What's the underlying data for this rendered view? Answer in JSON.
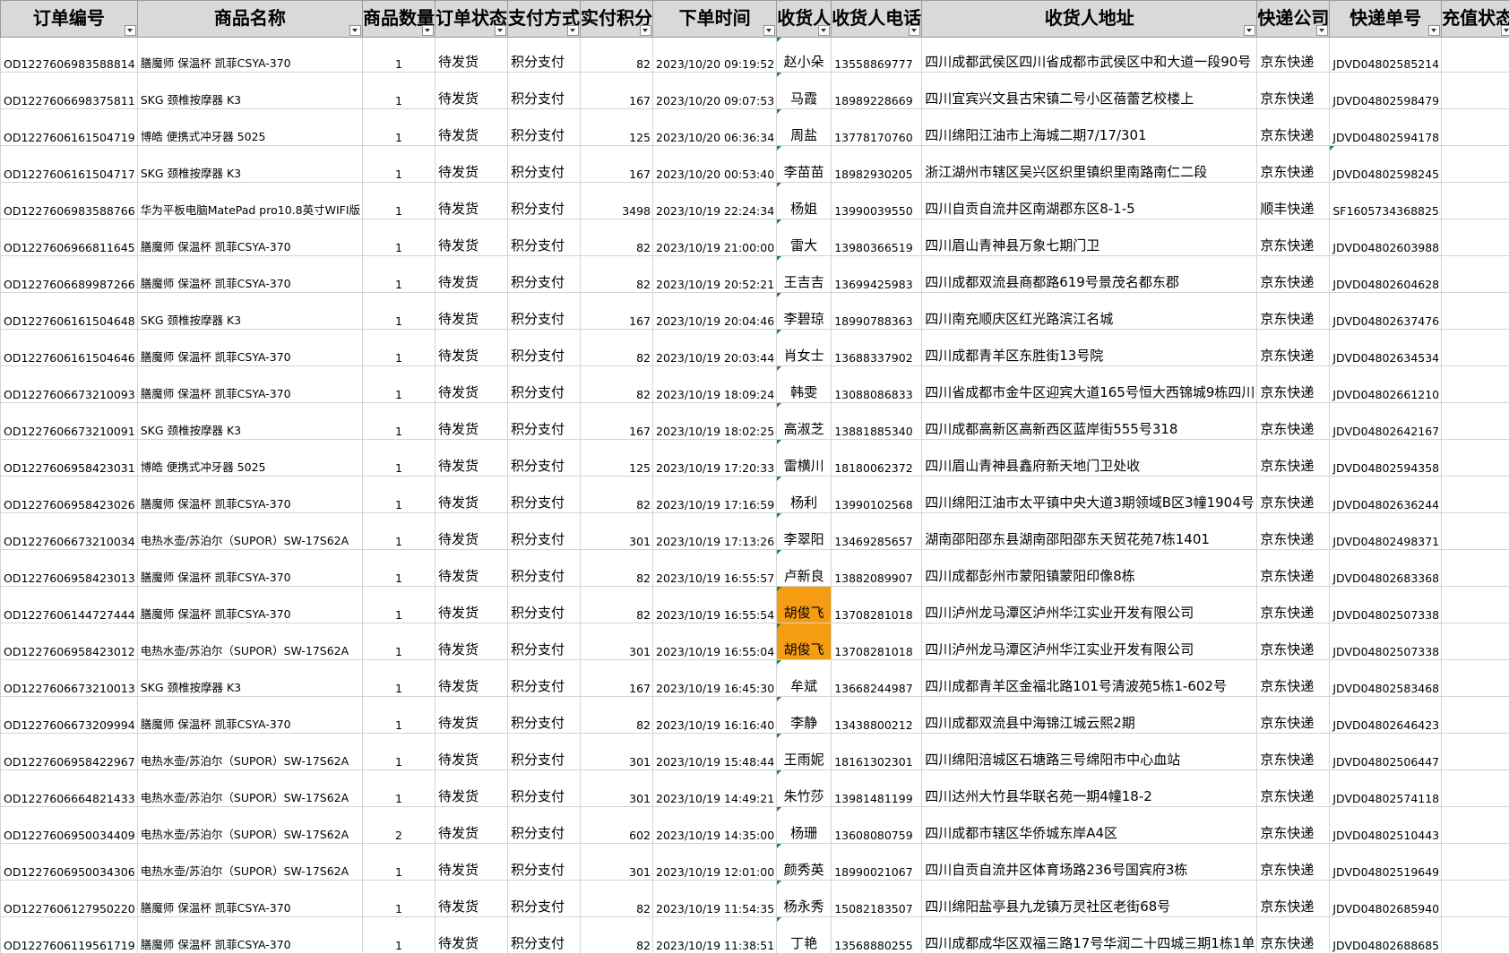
{
  "headers": [
    {
      "label": "订单编号"
    },
    {
      "label": "商品名称"
    },
    {
      "label": "商品数量"
    },
    {
      "label": "订单状态"
    },
    {
      "label": "支付方式"
    },
    {
      "label": "实付积分"
    },
    {
      "label": "下单时间"
    },
    {
      "label": "收货人"
    },
    {
      "label": "收货人电话"
    },
    {
      "label": "收货人地址"
    },
    {
      "label": "快递公司"
    },
    {
      "label": "快递单号"
    },
    {
      "label": "充值状态"
    }
  ],
  "highlight_color": "#f59c12",
  "rows": [
    {
      "order_id": "OD1227606983588814",
      "product": "膳魔师 保温杯 凯菲CSYA-370",
      "qty": "1",
      "status": "待发货",
      "pay": "积分支付",
      "points": "82",
      "time": "2023/10/20 09:19:52",
      "name": "赵小朵",
      "phone": "13558869777",
      "address": "四川成都武侯区四川省成都市武侯区中和大道一段90号",
      "courier": "京东快递",
      "tracking": "JDVD04802585214",
      "recharge": ""
    },
    {
      "order_id": "OD1227606698375811",
      "product": "SKG 颈椎按摩器 K3",
      "qty": "1",
      "status": "待发货",
      "pay": "积分支付",
      "points": "167",
      "time": "2023/10/20 09:07:53",
      "name": "马霞",
      "phone": "18989228669",
      "address": "四川宜宾兴文县古宋镇二号小区蓓蕾艺校楼上",
      "courier": "京东快递",
      "tracking": "JDVD04802598479",
      "recharge": ""
    },
    {
      "order_id": "OD1227606161504719",
      "product": "博皓 便携式冲牙器 5025",
      "qty": "1",
      "status": "待发货",
      "pay": "积分支付",
      "points": "125",
      "time": "2023/10/20 06:36:34",
      "name": "周盐",
      "phone": "13778170760",
      "address": "四川绵阳江油市上海城二期7/17/301",
      "courier": "京东快递",
      "tracking": "JDVD04802594178",
      "recharge": ""
    },
    {
      "order_id": "OD1227606161504717",
      "product": "SKG 颈椎按摩器 K3",
      "qty": "1",
      "status": "待发货",
      "pay": "积分支付",
      "points": "167",
      "time": "2023/10/20 00:53:40",
      "name": "李苗苗",
      "phone": "18982930205",
      "address": "浙江湖州市辖区吴兴区织里镇织里南路南仁二段",
      "courier": "京东快递",
      "tracking": "JDVD04802598245",
      "recharge": ""
    },
    {
      "order_id": "OD1227606983588766",
      "product": "华为平板电脑MatePad pro10.8英寸WIFI版",
      "qty": "1",
      "status": "待发货",
      "pay": "积分支付",
      "points": "3498",
      "time": "2023/10/19 22:24:34",
      "name": "杨姐",
      "phone": "13990039550",
      "address": "四川自贡自流井区南湖郡东区8-1-5",
      "courier": "顺丰快递",
      "tracking": "SF1605734368825",
      "recharge": ""
    },
    {
      "order_id": "OD1227606966811645",
      "product": "膳魔师 保温杯 凯菲CSYA-370",
      "qty": "1",
      "status": "待发货",
      "pay": "积分支付",
      "points": "82",
      "time": "2023/10/19 21:00:00",
      "name": "雷大",
      "phone": "13980366519",
      "address": "四川眉山青神县万象七期门卫",
      "courier": "京东快递",
      "tracking": "JDVD04802603988",
      "recharge": ""
    },
    {
      "order_id": "OD1227606689987266",
      "product": "膳魔师 保温杯 凯菲CSYA-370",
      "qty": "1",
      "status": "待发货",
      "pay": "积分支付",
      "points": "82",
      "time": "2023/10/19 20:52:21",
      "name": "王吉吉",
      "phone": "13699425983",
      "address": "四川成都双流县商都路619号景茂名都东郡",
      "courier": "京东快递",
      "tracking": "JDVD04802604628",
      "recharge": ""
    },
    {
      "order_id": "OD1227606161504648",
      "product": "SKG 颈椎按摩器 K3",
      "qty": "1",
      "status": "待发货",
      "pay": "积分支付",
      "points": "167",
      "time": "2023/10/19 20:04:46",
      "name": "李碧琼",
      "phone": "18990788363",
      "address": "四川南充顺庆区红光路滨江名城",
      "courier": "京东快递",
      "tracking": "JDVD04802637476",
      "recharge": ""
    },
    {
      "order_id": "OD1227606161504646",
      "product": "膳魔师 保温杯 凯菲CSYA-370",
      "qty": "1",
      "status": "待发货",
      "pay": "积分支付",
      "points": "82",
      "time": "2023/10/19 20:03:44",
      "name": "肖女士",
      "phone": "13688337902",
      "address": "四川成都青羊区东胜街13号院",
      "courier": "京东快递",
      "tracking": "JDVD04802634534",
      "recharge": ""
    },
    {
      "order_id": "OD1227606673210093",
      "product": "膳魔师 保温杯 凯菲CSYA-370",
      "qty": "1",
      "status": "待发货",
      "pay": "积分支付",
      "points": "82",
      "time": "2023/10/19 18:09:24",
      "name": "韩雯",
      "phone": "13088086833",
      "address": "四川省成都市金牛区迎宾大道165号恒大西锦城9栋四川",
      "courier": "京东快递",
      "tracking": "JDVD04802661210",
      "recharge": ""
    },
    {
      "order_id": "OD1227606673210091",
      "product": "SKG 颈椎按摩器 K3",
      "qty": "1",
      "status": "待发货",
      "pay": "积分支付",
      "points": "167",
      "time": "2023/10/19 18:02:25",
      "name": "高淑芝",
      "phone": "13881885340",
      "address": "四川成都高新区高新西区蓝岸街555号318",
      "courier": "京东快递",
      "tracking": "JDVD04802642167",
      "recharge": ""
    },
    {
      "order_id": "OD1227606958423031",
      "product": "博皓 便携式冲牙器 5025",
      "qty": "1",
      "status": "待发货",
      "pay": "积分支付",
      "points": "125",
      "time": "2023/10/19 17:20:33",
      "name": "雷横川",
      "phone": "18180062372",
      "address": "四川眉山青神县鑫府新天地门卫处收",
      "courier": "京东快递",
      "tracking": "JDVD04802594358",
      "recharge": ""
    },
    {
      "order_id": "OD1227606958423026",
      "product": "膳魔师 保温杯 凯菲CSYA-370",
      "qty": "1",
      "status": "待发货",
      "pay": "积分支付",
      "points": "82",
      "time": "2023/10/19 17:16:59",
      "name": "杨利",
      "phone": "13990102568",
      "address": "四川绵阳江油市太平镇中央大道3期领域B区3幢1904号",
      "courier": "京东快递",
      "tracking": "JDVD04802636244",
      "recharge": ""
    },
    {
      "order_id": "OD1227606673210034",
      "product": "电热水壶/苏泊尔（SUPOR）SW-17S62A",
      "qty": "1",
      "status": "待发货",
      "pay": "积分支付",
      "points": "301",
      "time": "2023/10/19 17:13:26",
      "name": "李翠阳",
      "phone": "13469285657",
      "address": "湖南邵阳邵东县湖南邵阳邵东天贸花苑7栋1401",
      "courier": "京东快递",
      "tracking": "JDVD04802498371",
      "recharge": ""
    },
    {
      "order_id": "OD1227606958423013",
      "product": "膳魔师 保温杯 凯菲CSYA-370",
      "qty": "1",
      "status": "待发货",
      "pay": "积分支付",
      "points": "82",
      "time": "2023/10/19 16:55:57",
      "name": "卢新良",
      "phone": "13882089907",
      "address": "四川成都彭州市蒙阳镇蒙阳印像8栋",
      "courier": "京东快递",
      "tracking": "JDVD04802683368",
      "recharge": ""
    },
    {
      "order_id": "OD1227606144727444",
      "product": "膳魔师 保温杯 凯菲CSYA-370",
      "qty": "1",
      "status": "待发货",
      "pay": "积分支付",
      "points": "82",
      "time": "2023/10/19 16:55:54",
      "name": "胡俊飞",
      "phone": "13708281018",
      "address": "四川泸州龙马潭区泸州华江实业开发有限公司",
      "courier": "京东快递",
      "tracking": "JDVD04802507338",
      "recharge": "",
      "hl": true
    },
    {
      "order_id": "OD1227606958423012",
      "product": "电热水壶/苏泊尔（SUPOR）SW-17S62A",
      "qty": "1",
      "status": "待发货",
      "pay": "积分支付",
      "points": "301",
      "time": "2023/10/19 16:55:04",
      "name": "胡俊飞",
      "phone": "13708281018",
      "address": "四川泸州龙马潭区泸州华江实业开发有限公司",
      "courier": "京东快递",
      "tracking": "JDVD04802507338",
      "recharge": "",
      "hl": true
    },
    {
      "order_id": "OD1227606673210013",
      "product": "SKG 颈椎按摩器 K3",
      "qty": "1",
      "status": "待发货",
      "pay": "积分支付",
      "points": "167",
      "time": "2023/10/19 16:45:30",
      "name": "牟斌",
      "phone": "13668244987",
      "address": "四川成都青羊区金福北路101号清波苑5栋1-602号",
      "courier": "京东快递",
      "tracking": "JDVD04802583468",
      "recharge": ""
    },
    {
      "order_id": "OD1227606673209994",
      "product": "膳魔师 保温杯 凯菲CSYA-370",
      "qty": "1",
      "status": "待发货",
      "pay": "积分支付",
      "points": "82",
      "time": "2023/10/19 16:16:40",
      "name": "李静",
      "phone": "13438800212",
      "address": "四川成都双流县中海锦江城云熙2期",
      "courier": "京东快递",
      "tracking": "JDVD04802646423",
      "recharge": ""
    },
    {
      "order_id": "OD1227606958422967",
      "product": "电热水壶/苏泊尔（SUPOR）SW-17S62A",
      "qty": "1",
      "status": "待发货",
      "pay": "积分支付",
      "points": "301",
      "time": "2023/10/19 15:48:44",
      "name": "王雨妮",
      "phone": "18161302301",
      "address": "四川绵阳涪城区石塘路三号绵阳市中心血站",
      "courier": "京东快递",
      "tracking": "JDVD04802506447",
      "recharge": ""
    },
    {
      "order_id": "OD1227606664821433",
      "product": "电热水壶/苏泊尔（SUPOR）SW-17S62A",
      "qty": "1",
      "status": "待发货",
      "pay": "积分支付",
      "points": "301",
      "time": "2023/10/19 14:49:21",
      "name": "朱竹莎",
      "phone": "13981481199",
      "address": "四川达州大竹县华联名苑一期4幢18-2",
      "courier": "京东快递",
      "tracking": "JDVD04802574118",
      "recharge": ""
    },
    {
      "order_id": "OD1227606950034409",
      "product": "电热水壶/苏泊尔（SUPOR）SW-17S62A",
      "qty": "2",
      "status": "待发货",
      "pay": "积分支付",
      "points": "602",
      "time": "2023/10/19 14:35:00",
      "name": "杨珊",
      "phone": "13608080759",
      "address": "四川成都市辖区华侨城东岸A4区",
      "courier": "京东快递",
      "tracking": "JDVD04802510443",
      "recharge": ""
    },
    {
      "order_id": "OD1227606950034306",
      "product": "电热水壶/苏泊尔（SUPOR）SW-17S62A",
      "qty": "1",
      "status": "待发货",
      "pay": "积分支付",
      "points": "301",
      "time": "2023/10/19 12:01:00",
      "name": "颜秀英",
      "phone": "18990021067",
      "address": "四川自贡自流井区体育场路236号国宾府3栋",
      "courier": "京东快递",
      "tracking": "JDVD04802519649",
      "recharge": ""
    },
    {
      "order_id": "OD1227606127950220",
      "product": "膳魔师 保温杯 凯菲CSYA-370",
      "qty": "1",
      "status": "待发货",
      "pay": "积分支付",
      "points": "82",
      "time": "2023/10/19 11:54:35",
      "name": "杨永秀",
      "phone": "15082183507",
      "address": "四川绵阳盐亭县九龙镇万灵社区老街68号",
      "courier": "京东快递",
      "tracking": "JDVD04802685940",
      "recharge": ""
    },
    {
      "order_id": "OD1227606119561719",
      "product": "膳魔师 保温杯 凯菲CSYA-370",
      "qty": "1",
      "status": "待发货",
      "pay": "积分支付",
      "points": "82",
      "time": "2023/10/19 11:38:51",
      "name": "丁艳",
      "phone": "13568880255",
      "address": "四川成都成华区双福三路17号华润二十四城三期1栋1单",
      "courier": "京东快递",
      "tracking": "JDVD04802688685",
      "recharge": ""
    }
  ]
}
